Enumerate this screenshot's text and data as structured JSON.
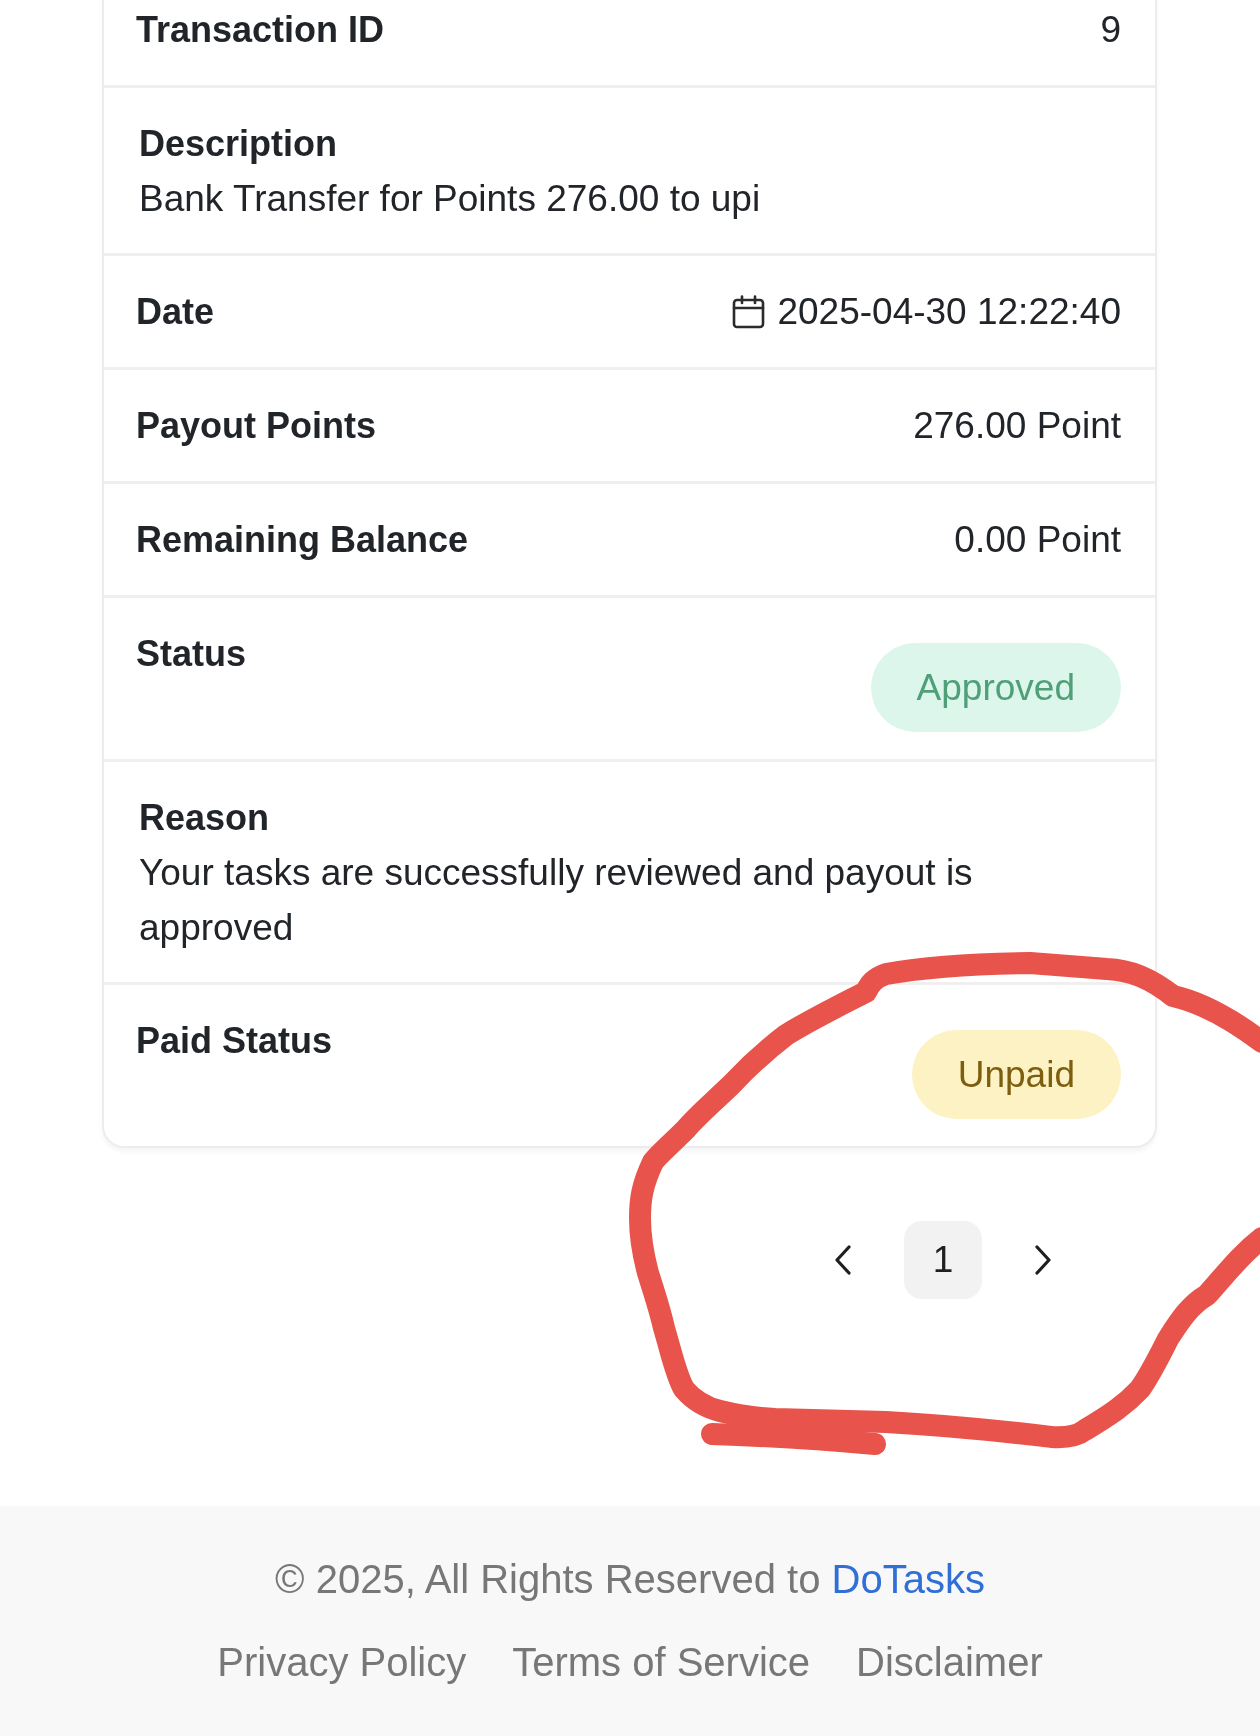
{
  "detail_rows": [
    {
      "kind": "inline",
      "label": "Transaction ID",
      "value": "9"
    },
    {
      "kind": "stacked",
      "label": "Description",
      "value": "Bank Transfer for Points 276.00 to upi"
    },
    {
      "kind": "date",
      "label": "Date",
      "value": "2025-04-30 12:22:40"
    },
    {
      "kind": "inline",
      "label": "Payout Points",
      "value": "276.00 Point"
    },
    {
      "kind": "inline",
      "label": "Remaining Balance",
      "value": "0.00 Point"
    },
    {
      "kind": "success",
      "label": "Status",
      "value": "Approved"
    },
    {
      "kind": "stacked",
      "label": "Reason",
      "value": "Your tasks are successfully reviewed and payout is approved"
    },
    {
      "kind": "warning",
      "label": "Paid Status",
      "value": "Unpaid"
    }
  ],
  "pagination": {
    "pages": [
      {
        "label": "1",
        "selected": true
      }
    ]
  },
  "footer": {
    "copyright": "© 2025, All Rights Reserved to",
    "brand_link": "DoTasks",
    "links": [
      "Privacy Policy",
      "Terms of Service",
      "Disclaimer"
    ]
  }
}
